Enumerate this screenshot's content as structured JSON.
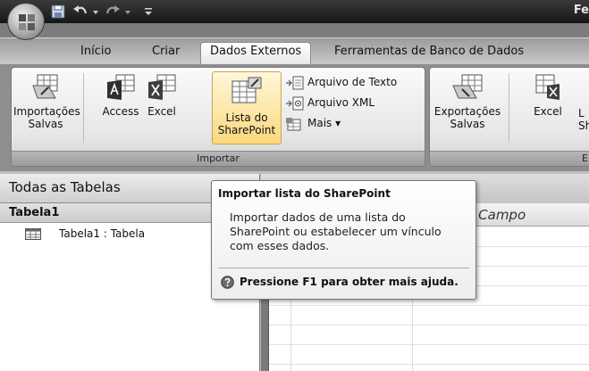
{
  "window": {
    "title_partial": "Fe"
  },
  "quick_access": {
    "icons": [
      "save-icon",
      "undo-icon",
      "redo-icon",
      "customize-icon"
    ]
  },
  "tabs": [
    {
      "label": "Início",
      "active": false
    },
    {
      "label": "Criar",
      "active": false
    },
    {
      "label": "Dados Externos",
      "active": true
    },
    {
      "label": "Ferramentas de Banco de Dados",
      "active": false
    }
  ],
  "ribbon": {
    "import_group": {
      "label": "Importar",
      "saved_imports": {
        "line1": "Importações",
        "line2": "Salvas"
      },
      "access": "Access",
      "excel": "Excel",
      "sharepoint": {
        "line1": "Lista do",
        "line2": "SharePoint"
      },
      "text_file": "Arquivo de Texto",
      "xml_file": "Arquivo XML",
      "more": "Mais ▾"
    },
    "export_group": {
      "label": "E",
      "saved_exports": {
        "line1": "Exportações",
        "line2": "Salvas"
      },
      "excel": "Excel",
      "sharepoint_partial": {
        "line1": "L",
        "line2": "Sh"
      }
    }
  },
  "nav": {
    "header": "Todas as Tabelas",
    "group": "Tabela1",
    "items": [
      {
        "label": "Tabela1 : Tabela"
      }
    ]
  },
  "sheet": {
    "add_field": "r Novo Campo"
  },
  "tooltip": {
    "title": "Importar lista do SharePoint",
    "body": "Importar dados de uma lista do SharePoint ou estabelecer um vínculo com esses dados.",
    "help": "Pressione F1 para obter mais ajuda."
  }
}
